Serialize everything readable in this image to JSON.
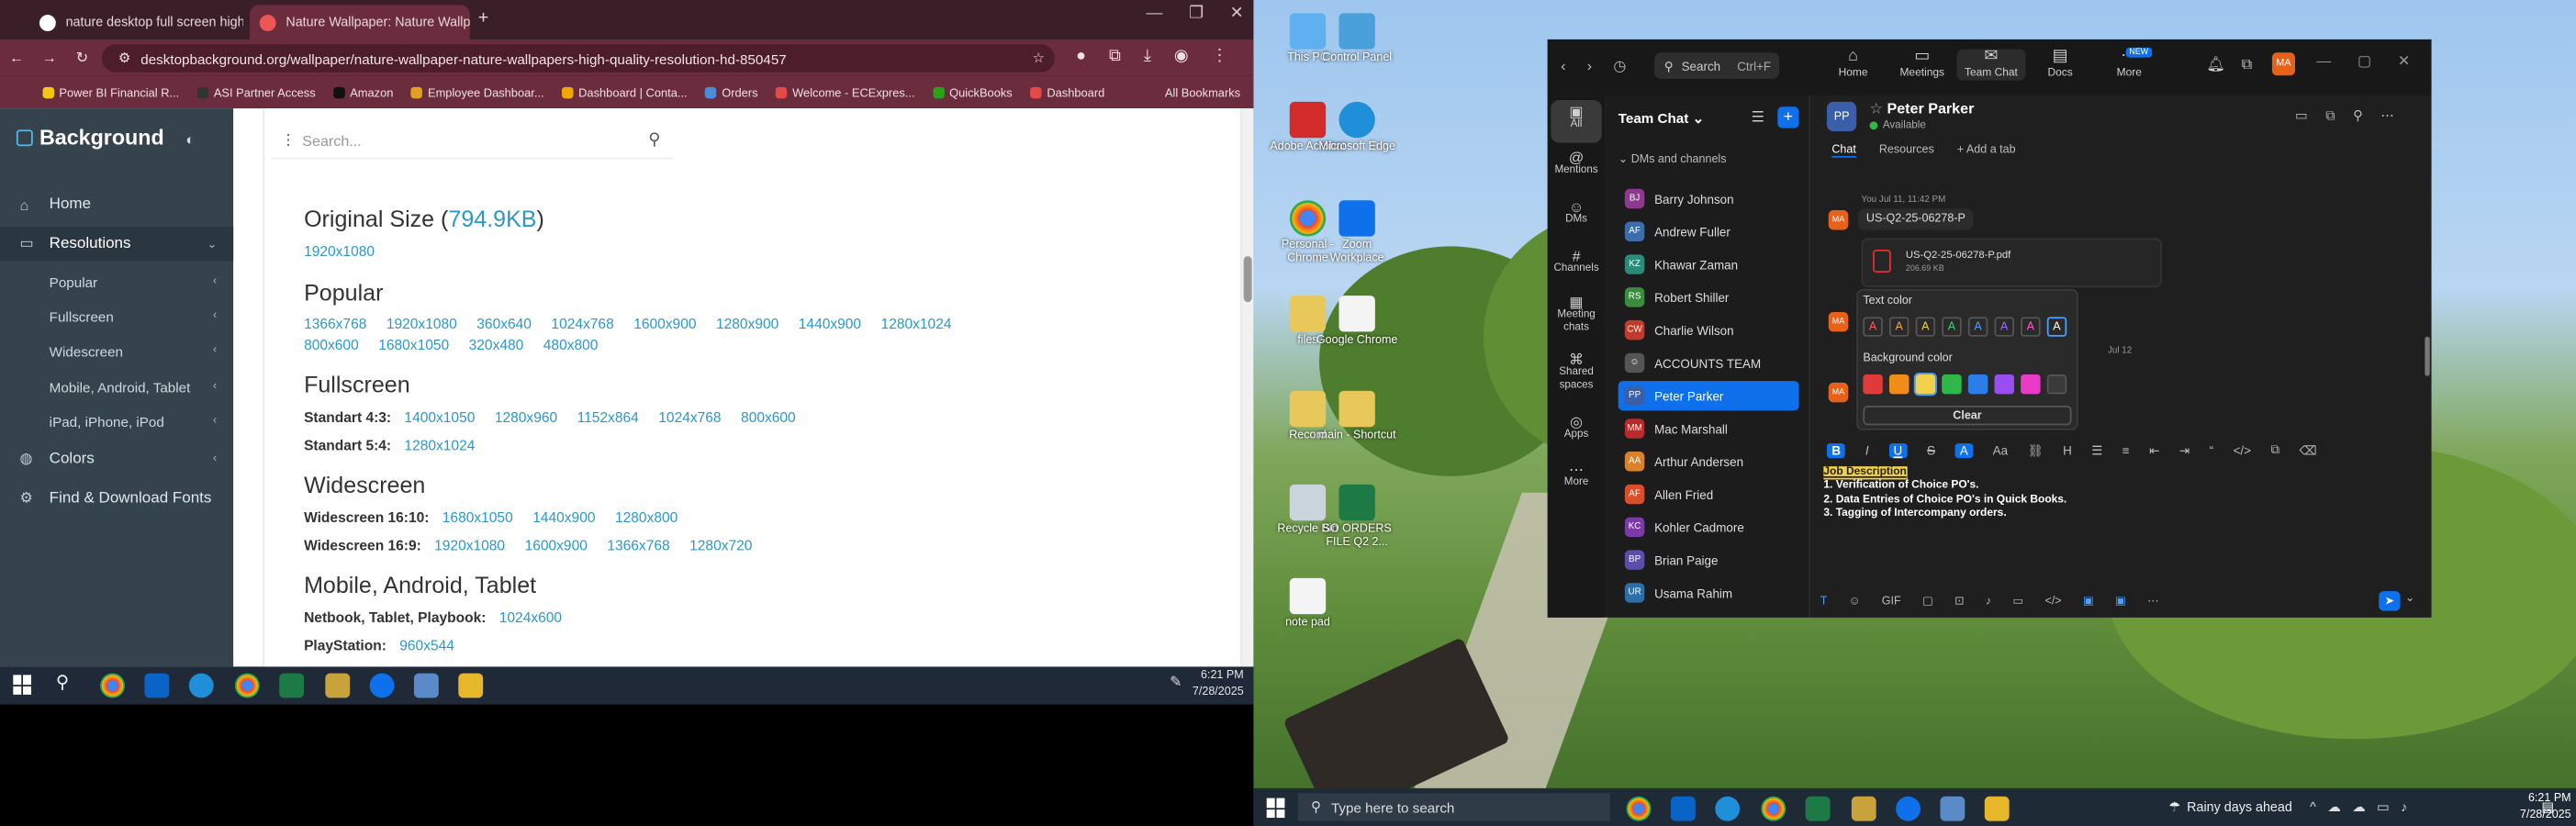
{
  "browser": {
    "tabs": [
      {
        "label": "nature desktop full screen high"
      },
      {
        "label": "Nature Wallpaper: Nature Wallp"
      }
    ],
    "new_tab": "+",
    "url": "desktopbackground.org/wallpaper/nature-wallpaper-nature-wallpapers-high-quality-resolution-hd-850457",
    "bookmarks": [
      "Power BI Financial R...",
      "ASI Partner Access",
      "Amazon",
      "Employee Dashboar...",
      "Dashboard | Conta...",
      "Orders",
      "Welcome - ECExpres...",
      "QuickBooks",
      "Dashboard"
    ],
    "all_bookmarks": "All Bookmarks",
    "accent": "#6b2c3e"
  },
  "site": {
    "brand": "Background",
    "menu": [
      {
        "label": "Home"
      },
      {
        "label": "Resolutions"
      },
      {
        "label": "Popular"
      },
      {
        "label": "Fullscreen"
      },
      {
        "label": "Widescreen"
      },
      {
        "label": "Mobile, Android, Tablet"
      },
      {
        "label": "iPad, iPhone, iPod"
      },
      {
        "label": "Colors"
      },
      {
        "label": "Find & Download Fonts"
      }
    ],
    "search_placeholder": "Search...",
    "original_size": {
      "title": "Original Size (",
      "size": "794.9KB",
      "close": ")",
      "resolution": "1920x1080"
    },
    "popular": {
      "title": "Popular",
      "row1": [
        "1366x768",
        "1920x1080",
        "360x640",
        "1024x768",
        "1600x900",
        "1280x900",
        "1440x900",
        "1280x1024"
      ],
      "row2": [
        "800x600",
        "1680x1050",
        "320x480",
        "480x800"
      ]
    },
    "fullscreen": {
      "title": "Fullscreen",
      "r43_label": "Standart 4:3:",
      "r43": [
        "1400x1050",
        "1280x960",
        "1152x864",
        "1024x768",
        "800x600"
      ],
      "r54_label": "Standart 5:4:",
      "r54": [
        "1280x1024"
      ]
    },
    "widescreen": {
      "title": "Widescreen",
      "r1610_label": "Widescreen 16:10:",
      "r1610": [
        "1680x1050",
        "1440x900",
        "1280x800"
      ],
      "r169_label": "Widescreen 16:9:",
      "r169": [
        "1920x1080",
        "1600x900",
        "1366x768",
        "1280x720"
      ]
    },
    "mobile": {
      "title": "Mobile, Android, Tablet",
      "netbook_label": "Netbook, Tablet, Playbook:",
      "netbook": "1024x600",
      "playstation_label": "PlayStation:",
      "playstation": "960x544"
    }
  },
  "taskbar1": {
    "time": "6:21 PM",
    "date": "7/28/2025"
  },
  "desktop": {
    "icons": [
      {
        "label": "This PC"
      },
      {
        "label": "Control Panel"
      },
      {
        "label": "Adobe Acrobat"
      },
      {
        "label": "Microsoft Edge"
      },
      {
        "label": "Personal - Chrome"
      },
      {
        "label": "Zoom Workplace"
      },
      {
        "label": "files"
      },
      {
        "label": "Google Chrome"
      },
      {
        "label": "Record"
      },
      {
        "label": "main - Shortcut"
      },
      {
        "label": "Recycle Bin"
      },
      {
        "label": "SO ORDERS FILE Q2 2..."
      },
      {
        "label": "note pad"
      }
    ]
  },
  "zoom": {
    "search": "Search",
    "shortcut": "Ctrl+F",
    "nav": [
      {
        "label": "Home"
      },
      {
        "label": "Meetings"
      },
      {
        "label": "Team Chat"
      },
      {
        "label": "Docs"
      },
      {
        "label": "More"
      }
    ],
    "new_badge": "NEW",
    "avatar": "MA",
    "rail": [
      {
        "label": "All"
      },
      {
        "label": "Mentions"
      },
      {
        "label": "DMs"
      },
      {
        "label": "Channels"
      },
      {
        "label": "Meeting chats"
      },
      {
        "label": "Shared spaces"
      },
      {
        "label": "Apps"
      },
      {
        "label": "More"
      }
    ],
    "panel_title": "Team Chat",
    "section": "DMs and channels",
    "contacts": [
      {
        "name": "Barry Johnson",
        "initials": "BJ",
        "color": "#8b3a8f"
      },
      {
        "name": "Andrew Fuller",
        "initials": "AF",
        "color": "#3b6ea8"
      },
      {
        "name": "Khawar Zaman",
        "initials": "KZ",
        "color": "#2b8a7a"
      },
      {
        "name": "Robert Shiller",
        "initials": "RS",
        "color": "#3a8c3e"
      },
      {
        "name": "Charlie Wilson",
        "initials": "CW",
        "color": "#c23a2b"
      },
      {
        "name": "ACCOUNTS TEAM",
        "initials": "",
        "color": "#555555"
      },
      {
        "name": "Peter Parker",
        "initials": "PP",
        "color": "#3b5ea8"
      },
      {
        "name": "Mac Marshall",
        "initials": "MM",
        "color": "#b82b2b"
      },
      {
        "name": "Arthur Andersen",
        "initials": "AA",
        "color": "#d9822b"
      },
      {
        "name": "Allen Fried",
        "initials": "AF",
        "color": "#d94f2b"
      },
      {
        "name": "Kohler Cadmore",
        "initials": "KC",
        "color": "#7b3aa8"
      },
      {
        "name": "Brian Paige",
        "initials": "BP",
        "color": "#5a4ea8"
      },
      {
        "name": "Usama Rahim",
        "initials": "UR",
        "color": "#2b6ea8"
      }
    ],
    "chat": {
      "name": "Peter Parker",
      "initials": "PP",
      "status": "Available",
      "tabs": [
        "Chat",
        "Resources",
        "+ Add a tab"
      ],
      "timestamp": "You Jul 11, 11:42 PM",
      "msg1": "US-Q2-25-06278-P",
      "file_name": "US-Q2-25-06278-P.pdf",
      "file_size": "206.69 KB",
      "date_divider": "Jul 12",
      "sender": "MA"
    },
    "popup": {
      "text_color_label": "Text color",
      "text_colors": [
        "#ff5a5a",
        "#ff9f40",
        "#f3d14b",
        "#3fcf6b",
        "#4aa0ff",
        "#9a6bff",
        "#ff5ac8",
        "#ffffff"
      ],
      "glyph": "A",
      "background_label": "Background color",
      "bg_colors": [
        "#e03b3b",
        "#f08c1a",
        "#f3d14b",
        "#2fb84a",
        "#2b7de9",
        "#9a4ef0",
        "#e93bc8",
        "#3a3a3a"
      ],
      "clear": "Clear"
    },
    "draft": {
      "line0": "Job Description",
      "line1": "1. Verification of Choice PO's.",
      "line2": "2. Data Entries of Choice PO's in Quick Books.",
      "line3": "3. Tagging of Intercompany orders."
    },
    "gif": "GIF"
  },
  "taskbar2": {
    "search": "Type here to search",
    "weather": "Rainy days ahead",
    "time": "6:21 PM",
    "date": "7/28/2025"
  }
}
